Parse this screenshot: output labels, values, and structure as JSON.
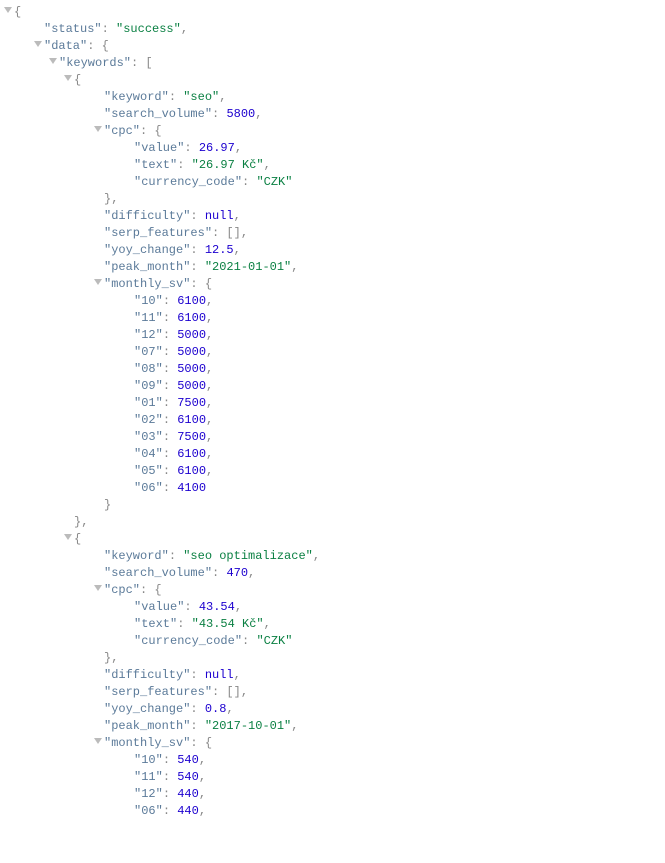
{
  "lines": [
    {
      "arrow": 4,
      "indent": 14,
      "tokens": [
        [
          "punc",
          "{"
        ]
      ]
    },
    {
      "arrow": null,
      "indent": 44,
      "tokens": [
        [
          "jkey",
          "\"status\""
        ],
        [
          "punc",
          ": "
        ],
        [
          "str",
          "\"success\""
        ],
        [
          "punc",
          ","
        ]
      ]
    },
    {
      "arrow": 34,
      "indent": 44,
      "tokens": [
        [
          "jkey",
          "\"data\""
        ],
        [
          "punc",
          ": {"
        ]
      ]
    },
    {
      "arrow": 49,
      "indent": 59,
      "tokens": [
        [
          "jkey",
          "\"keywords\""
        ],
        [
          "punc",
          ": ["
        ]
      ]
    },
    {
      "arrow": 64,
      "indent": 74,
      "tokens": [
        [
          "punc",
          "{"
        ]
      ]
    },
    {
      "arrow": null,
      "indent": 104,
      "tokens": [
        [
          "jkey",
          "\"keyword\""
        ],
        [
          "punc",
          ": "
        ],
        [
          "str",
          "\"seo\""
        ],
        [
          "punc",
          ","
        ]
      ]
    },
    {
      "arrow": null,
      "indent": 104,
      "tokens": [
        [
          "jkey",
          "\"search_volume\""
        ],
        [
          "punc",
          ": "
        ],
        [
          "num",
          "5800"
        ],
        [
          "punc",
          ","
        ]
      ]
    },
    {
      "arrow": 94,
      "indent": 104,
      "tokens": [
        [
          "jkey",
          "\"cpc\""
        ],
        [
          "punc",
          ": {"
        ]
      ]
    },
    {
      "arrow": null,
      "indent": 134,
      "tokens": [
        [
          "jkey",
          "\"value\""
        ],
        [
          "punc",
          ": "
        ],
        [
          "num",
          "26.97"
        ],
        [
          "punc",
          ","
        ]
      ]
    },
    {
      "arrow": null,
      "indent": 134,
      "tokens": [
        [
          "jkey",
          "\"text\""
        ],
        [
          "punc",
          ": "
        ],
        [
          "str",
          "\"26.97 Kč\""
        ],
        [
          "punc",
          ","
        ]
      ]
    },
    {
      "arrow": null,
      "indent": 134,
      "tokens": [
        [
          "jkey",
          "\"currency_code\""
        ],
        [
          "punc",
          ": "
        ],
        [
          "str",
          "\"CZK\""
        ]
      ]
    },
    {
      "arrow": null,
      "indent": 104,
      "tokens": [
        [
          "punc",
          "},"
        ]
      ]
    },
    {
      "arrow": null,
      "indent": 104,
      "tokens": [
        [
          "jkey",
          "\"difficulty\""
        ],
        [
          "punc",
          ": "
        ],
        [
          "null",
          "null"
        ],
        [
          "punc",
          ","
        ]
      ]
    },
    {
      "arrow": null,
      "indent": 104,
      "tokens": [
        [
          "jkey",
          "\"serp_features\""
        ],
        [
          "punc",
          ": [],"
        ]
      ]
    },
    {
      "arrow": null,
      "indent": 104,
      "tokens": [
        [
          "jkey",
          "\"yoy_change\""
        ],
        [
          "punc",
          ": "
        ],
        [
          "num",
          "12.5"
        ],
        [
          "punc",
          ","
        ]
      ]
    },
    {
      "arrow": null,
      "indent": 104,
      "tokens": [
        [
          "jkey",
          "\"peak_month\""
        ],
        [
          "punc",
          ": "
        ],
        [
          "str",
          "\"2021-01-01\""
        ],
        [
          "punc",
          ","
        ]
      ]
    },
    {
      "arrow": 94,
      "indent": 104,
      "tokens": [
        [
          "jkey",
          "\"monthly_sv\""
        ],
        [
          "punc",
          ": {"
        ]
      ]
    },
    {
      "arrow": null,
      "indent": 134,
      "tokens": [
        [
          "jkey",
          "\"10\""
        ],
        [
          "punc",
          ": "
        ],
        [
          "num",
          "6100"
        ],
        [
          "punc",
          ","
        ]
      ]
    },
    {
      "arrow": null,
      "indent": 134,
      "tokens": [
        [
          "jkey",
          "\"11\""
        ],
        [
          "punc",
          ": "
        ],
        [
          "num",
          "6100"
        ],
        [
          "punc",
          ","
        ]
      ]
    },
    {
      "arrow": null,
      "indent": 134,
      "tokens": [
        [
          "jkey",
          "\"12\""
        ],
        [
          "punc",
          ": "
        ],
        [
          "num",
          "5000"
        ],
        [
          "punc",
          ","
        ]
      ]
    },
    {
      "arrow": null,
      "indent": 134,
      "tokens": [
        [
          "jkey",
          "\"07\""
        ],
        [
          "punc",
          ": "
        ],
        [
          "num",
          "5000"
        ],
        [
          "punc",
          ","
        ]
      ]
    },
    {
      "arrow": null,
      "indent": 134,
      "tokens": [
        [
          "jkey",
          "\"08\""
        ],
        [
          "punc",
          ": "
        ],
        [
          "num",
          "5000"
        ],
        [
          "punc",
          ","
        ]
      ]
    },
    {
      "arrow": null,
      "indent": 134,
      "tokens": [
        [
          "jkey",
          "\"09\""
        ],
        [
          "punc",
          ": "
        ],
        [
          "num",
          "5000"
        ],
        [
          "punc",
          ","
        ]
      ]
    },
    {
      "arrow": null,
      "indent": 134,
      "tokens": [
        [
          "jkey",
          "\"01\""
        ],
        [
          "punc",
          ": "
        ],
        [
          "num",
          "7500"
        ],
        [
          "punc",
          ","
        ]
      ]
    },
    {
      "arrow": null,
      "indent": 134,
      "tokens": [
        [
          "jkey",
          "\"02\""
        ],
        [
          "punc",
          ": "
        ],
        [
          "num",
          "6100"
        ],
        [
          "punc",
          ","
        ]
      ]
    },
    {
      "arrow": null,
      "indent": 134,
      "tokens": [
        [
          "jkey",
          "\"03\""
        ],
        [
          "punc",
          ": "
        ],
        [
          "num",
          "7500"
        ],
        [
          "punc",
          ","
        ]
      ]
    },
    {
      "arrow": null,
      "indent": 134,
      "tokens": [
        [
          "jkey",
          "\"04\""
        ],
        [
          "punc",
          ": "
        ],
        [
          "num",
          "6100"
        ],
        [
          "punc",
          ","
        ]
      ]
    },
    {
      "arrow": null,
      "indent": 134,
      "tokens": [
        [
          "jkey",
          "\"05\""
        ],
        [
          "punc",
          ": "
        ],
        [
          "num",
          "6100"
        ],
        [
          "punc",
          ","
        ]
      ]
    },
    {
      "arrow": null,
      "indent": 134,
      "tokens": [
        [
          "jkey",
          "\"06\""
        ],
        [
          "punc",
          ": "
        ],
        [
          "num",
          "4100"
        ]
      ]
    },
    {
      "arrow": null,
      "indent": 104,
      "tokens": [
        [
          "punc",
          "}"
        ]
      ]
    },
    {
      "arrow": null,
      "indent": 74,
      "tokens": [
        [
          "punc",
          "},"
        ]
      ]
    },
    {
      "arrow": 64,
      "indent": 74,
      "tokens": [
        [
          "punc",
          "{"
        ]
      ]
    },
    {
      "arrow": null,
      "indent": 104,
      "tokens": [
        [
          "jkey",
          "\"keyword\""
        ],
        [
          "punc",
          ": "
        ],
        [
          "str",
          "\"seo optimalizace\""
        ],
        [
          "punc",
          ","
        ]
      ]
    },
    {
      "arrow": null,
      "indent": 104,
      "tokens": [
        [
          "jkey",
          "\"search_volume\""
        ],
        [
          "punc",
          ": "
        ],
        [
          "num",
          "470"
        ],
        [
          "punc",
          ","
        ]
      ]
    },
    {
      "arrow": 94,
      "indent": 104,
      "tokens": [
        [
          "jkey",
          "\"cpc\""
        ],
        [
          "punc",
          ": {"
        ]
      ]
    },
    {
      "arrow": null,
      "indent": 134,
      "tokens": [
        [
          "jkey",
          "\"value\""
        ],
        [
          "punc",
          ": "
        ],
        [
          "num",
          "43.54"
        ],
        [
          "punc",
          ","
        ]
      ]
    },
    {
      "arrow": null,
      "indent": 134,
      "tokens": [
        [
          "jkey",
          "\"text\""
        ],
        [
          "punc",
          ": "
        ],
        [
          "str",
          "\"43.54 Kč\""
        ],
        [
          "punc",
          ","
        ]
      ]
    },
    {
      "arrow": null,
      "indent": 134,
      "tokens": [
        [
          "jkey",
          "\"currency_code\""
        ],
        [
          "punc",
          ": "
        ],
        [
          "str",
          "\"CZK\""
        ]
      ]
    },
    {
      "arrow": null,
      "indent": 104,
      "tokens": [
        [
          "punc",
          "},"
        ]
      ]
    },
    {
      "arrow": null,
      "indent": 104,
      "tokens": [
        [
          "jkey",
          "\"difficulty\""
        ],
        [
          "punc",
          ": "
        ],
        [
          "null",
          "null"
        ],
        [
          "punc",
          ","
        ]
      ]
    },
    {
      "arrow": null,
      "indent": 104,
      "tokens": [
        [
          "jkey",
          "\"serp_features\""
        ],
        [
          "punc",
          ": [],"
        ]
      ]
    },
    {
      "arrow": null,
      "indent": 104,
      "tokens": [
        [
          "jkey",
          "\"yoy_change\""
        ],
        [
          "punc",
          ": "
        ],
        [
          "num",
          "0.8"
        ],
        [
          "punc",
          ","
        ]
      ]
    },
    {
      "arrow": null,
      "indent": 104,
      "tokens": [
        [
          "jkey",
          "\"peak_month\""
        ],
        [
          "punc",
          ": "
        ],
        [
          "str",
          "\"2017-10-01\""
        ],
        [
          "punc",
          ","
        ]
      ]
    },
    {
      "arrow": 94,
      "indent": 104,
      "tokens": [
        [
          "jkey",
          "\"monthly_sv\""
        ],
        [
          "punc",
          ": {"
        ]
      ]
    },
    {
      "arrow": null,
      "indent": 134,
      "tokens": [
        [
          "jkey",
          "\"10\""
        ],
        [
          "punc",
          ": "
        ],
        [
          "num",
          "540"
        ],
        [
          "punc",
          ","
        ]
      ]
    },
    {
      "arrow": null,
      "indent": 134,
      "tokens": [
        [
          "jkey",
          "\"11\""
        ],
        [
          "punc",
          ": "
        ],
        [
          "num",
          "540"
        ],
        [
          "punc",
          ","
        ]
      ]
    },
    {
      "arrow": null,
      "indent": 134,
      "tokens": [
        [
          "jkey",
          "\"12\""
        ],
        [
          "punc",
          ": "
        ],
        [
          "num",
          "440"
        ],
        [
          "punc",
          ","
        ]
      ]
    },
    {
      "arrow": null,
      "indent": 134,
      "tokens": [
        [
          "jkey",
          "\"06\""
        ],
        [
          "punc",
          ": "
        ],
        [
          "num",
          "440"
        ],
        [
          "punc",
          ","
        ]
      ]
    }
  ]
}
